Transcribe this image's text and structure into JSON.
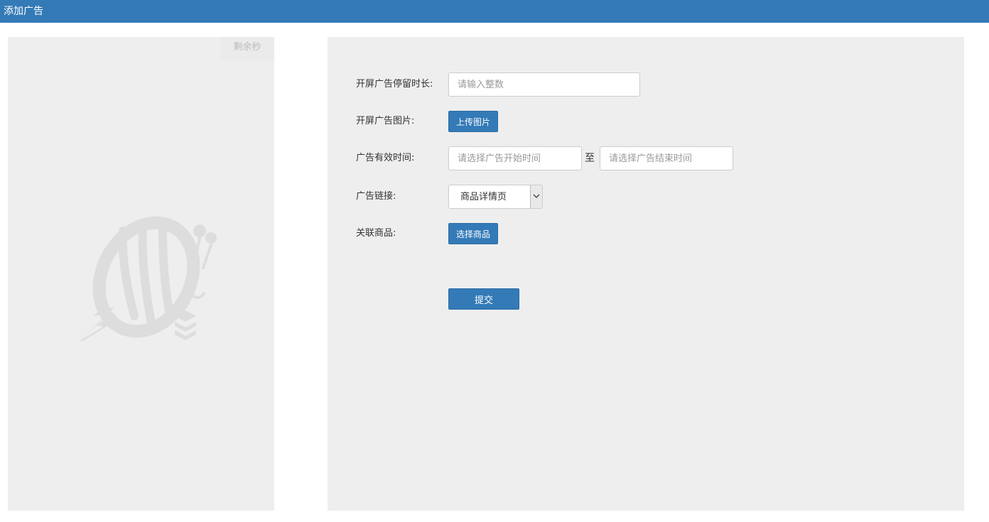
{
  "header": {
    "title": "添加广告"
  },
  "preview": {
    "countdown_label": "剩余秒"
  },
  "form": {
    "duration": {
      "label": "开屏广告停留时长:",
      "placeholder": "请输入整数",
      "value": ""
    },
    "image": {
      "label": "开屏广告图片:",
      "button": "上传图片"
    },
    "valid_time": {
      "label": "广告有效时间:",
      "start_placeholder": "请选择广告开始时间",
      "separator": "至",
      "end_placeholder": "请选择广告结束时间"
    },
    "link": {
      "label": "广告链接:",
      "selected": "商品详情页"
    },
    "goods": {
      "label": "关联商品:",
      "button": "选择商品"
    },
    "submit": "提交"
  },
  "colors": {
    "primary": "#337ab7",
    "panel_bg": "#eeeeee",
    "placeholder": "#999999"
  },
  "icons": {
    "logo": "bee-logo-icon",
    "select_arrow": "chevron-down-icon"
  }
}
